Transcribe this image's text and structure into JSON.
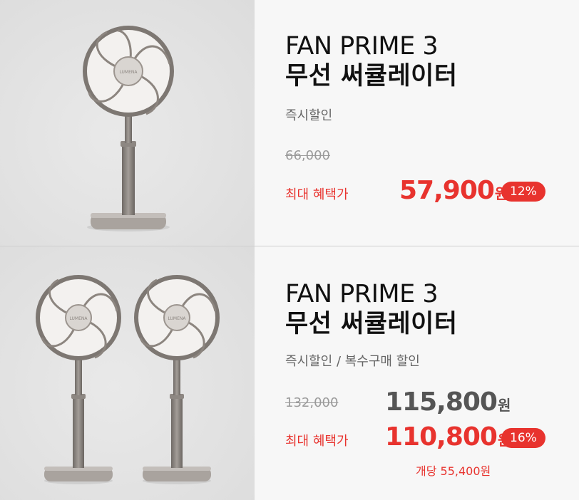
{
  "products": [
    {
      "title_line1": "FAN PRIME 3",
      "title_line2": "무선 써큘레이터",
      "subtitle": "즉시할인",
      "original_price": "66,000",
      "benefit_label": "최대 혜택가",
      "final_price": "57,900",
      "currency": "원",
      "discount_badge": "12%",
      "fan_logo": "LUMENA"
    },
    {
      "title_line1": "FAN PRIME 3",
      "title_line2": "무선 써큘레이터",
      "subtitle": "즉시할인 / 복수구매 할인",
      "original_price": "132,000",
      "sale_price": "115,800",
      "benefit_label": "최대 혜택가",
      "final_price": "110,800",
      "currency": "원",
      "discount_badge": "16%",
      "unit_price": "개당 55,400원",
      "fan_logo": "LUMENA"
    }
  ],
  "colors": {
    "accent": "#e8332e",
    "fan_body": "#8f8882",
    "fan_base": "#a9a39e"
  }
}
